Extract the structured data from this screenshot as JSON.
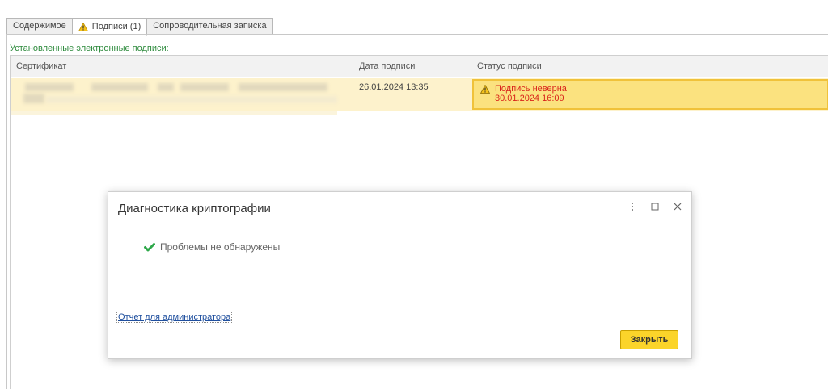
{
  "tabs": [
    {
      "label": "Содержимое"
    },
    {
      "label": "Подписи (1)",
      "icon": "warning-icon",
      "active": true
    },
    {
      "label": "Сопроводительная записка"
    }
  ],
  "section": {
    "label": "Установленные электронные подписи:"
  },
  "table": {
    "columns": [
      "Сертификат",
      "Дата подписи",
      "Статус подписи"
    ],
    "rows": [
      {
        "date": "26.01.2024 13:35",
        "status": "Подпись неверна",
        "status_date": "30.01.2024 16:09"
      }
    ]
  },
  "dialog": {
    "title": "Диагностика криптографии",
    "message": "Проблемы не обнаружены",
    "link": "Отчет для администратора",
    "close_label": "Закрыть",
    "controls": [
      "more-icon",
      "maximize-icon",
      "close-icon"
    ]
  },
  "colors": {
    "accent_yellow": "#fbd42a",
    "row_highlight": "#fdf2cc",
    "status_cell": "#fbe27f",
    "error_red": "#d9241b",
    "success_green": "#2e8b3d"
  }
}
